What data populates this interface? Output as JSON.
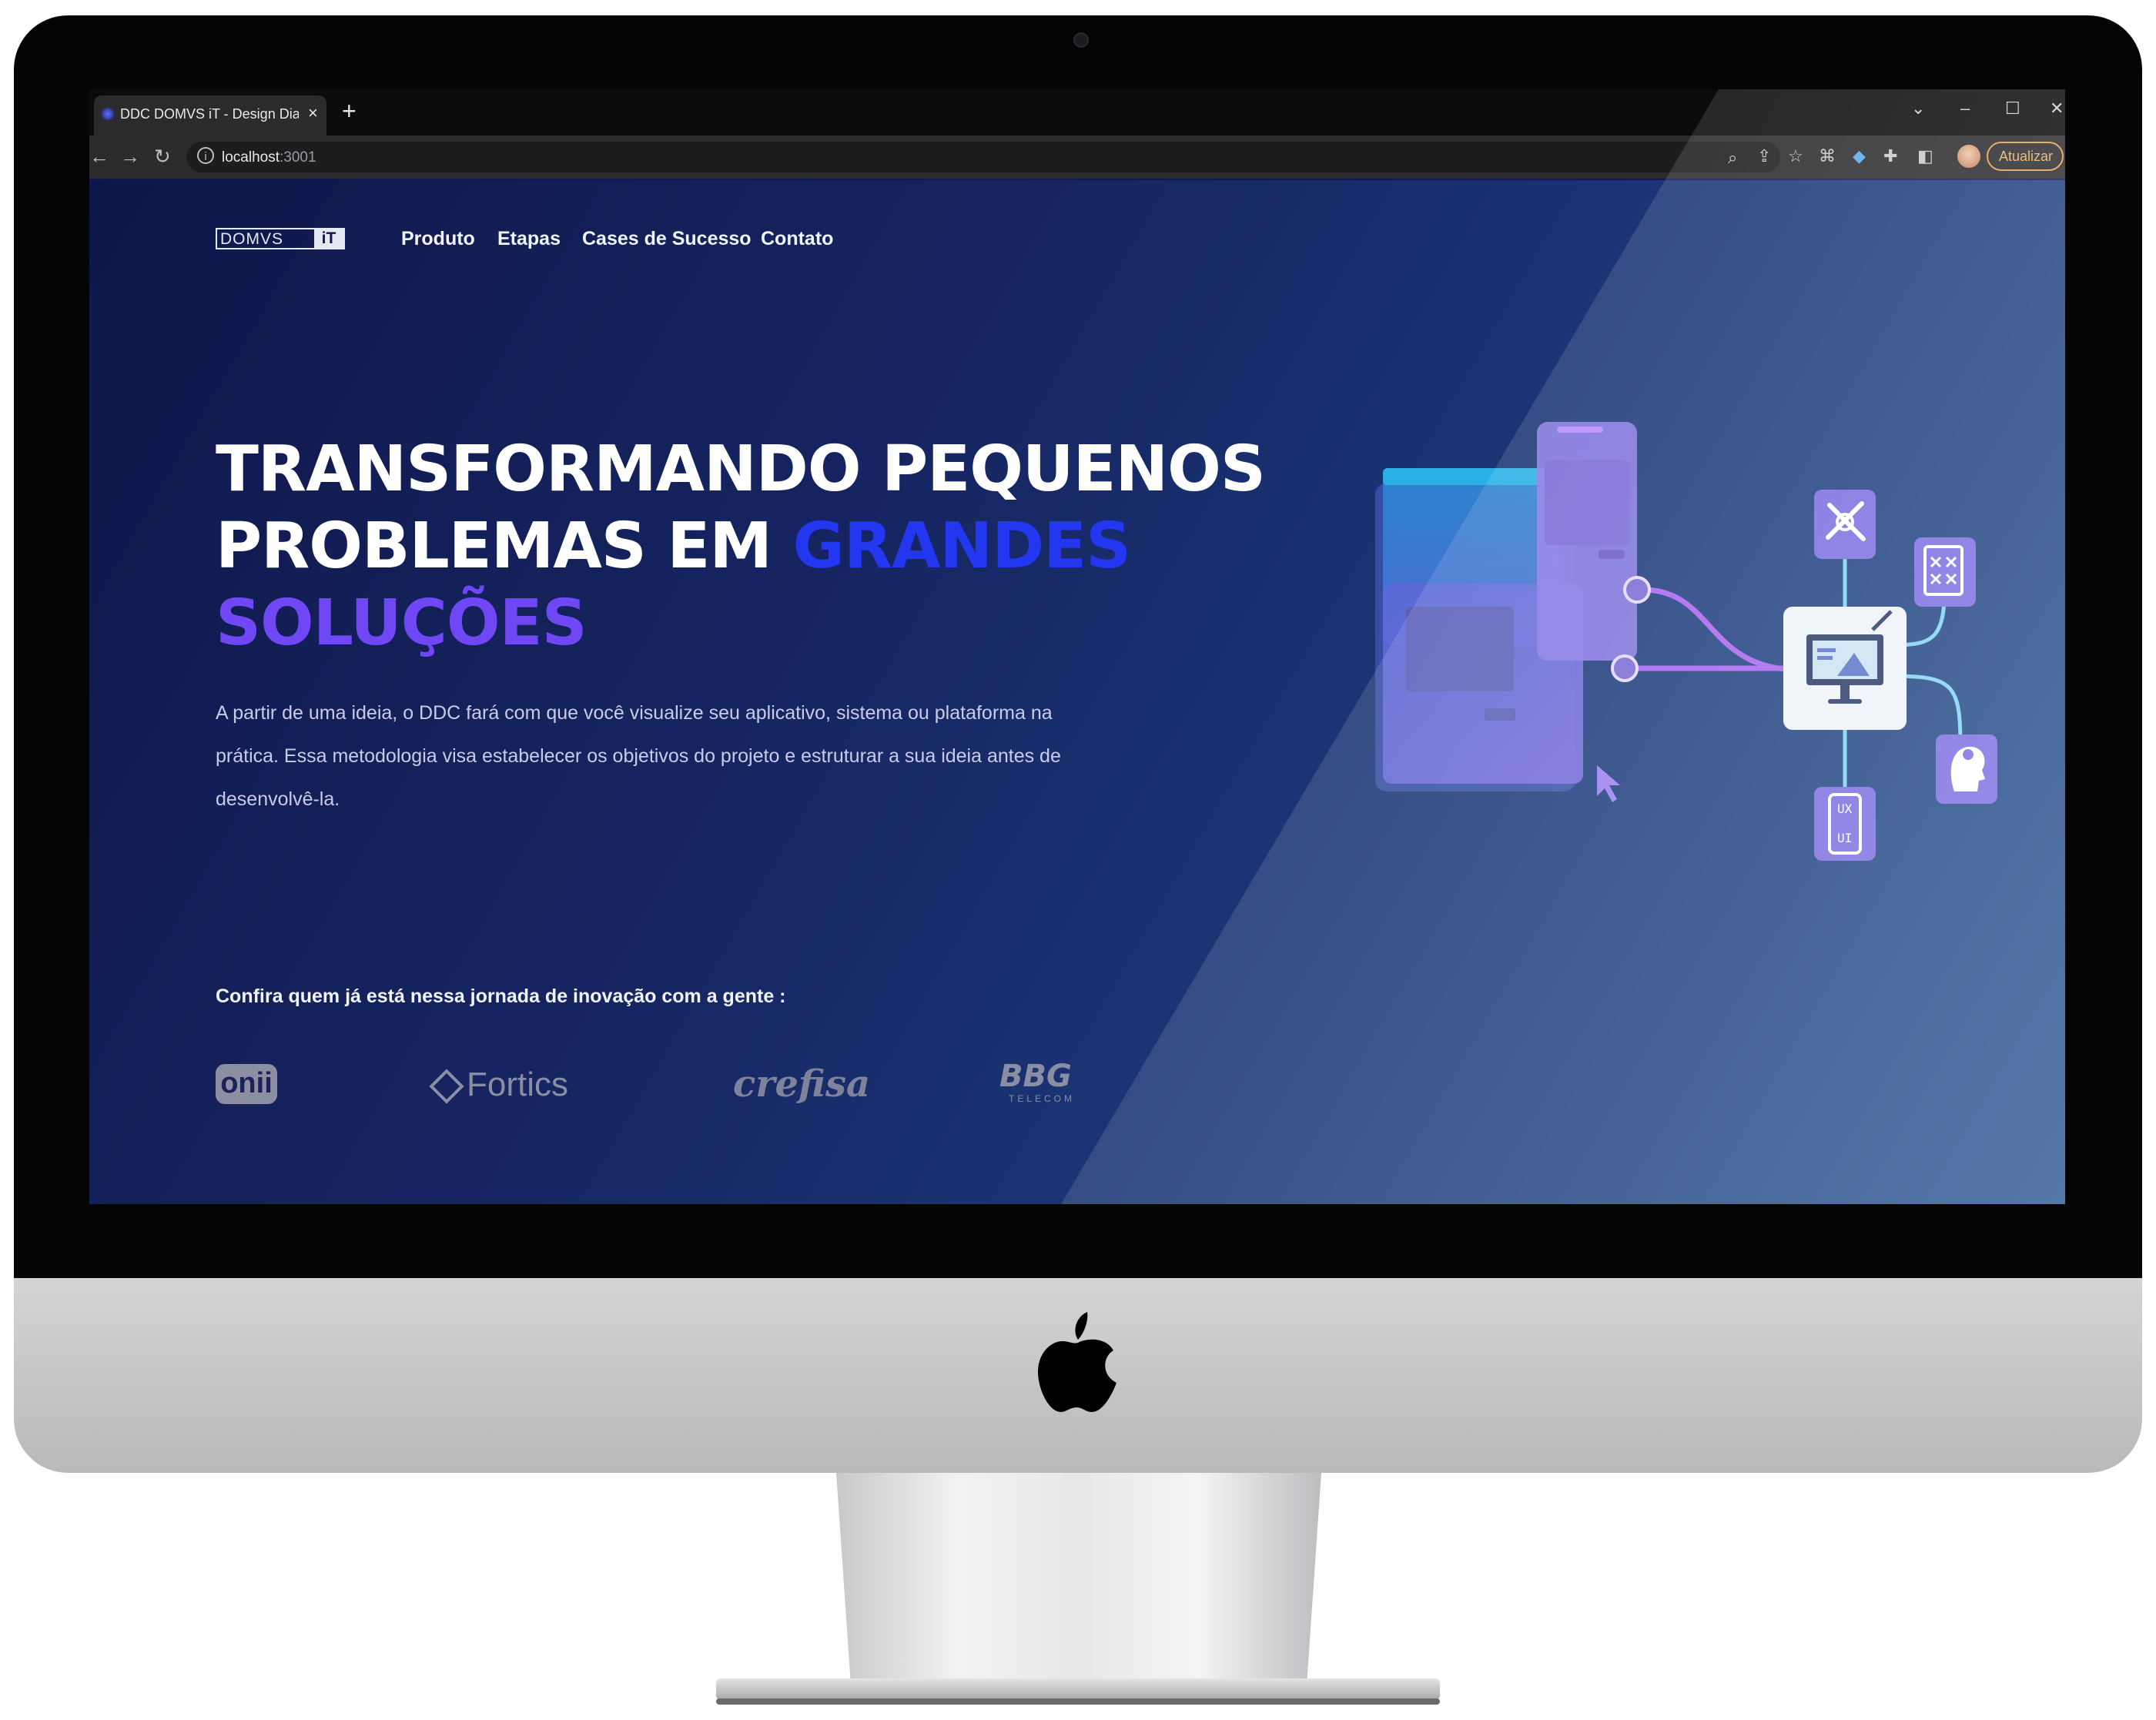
{
  "browser": {
    "tab_title": "DDC DOMVS iT - Design Diamond",
    "tab_close": "×",
    "new_tab": "+",
    "url_host": "localhost",
    "url_port": ":3001",
    "update_label": "Atualizar",
    "window_controls": [
      "chevron-down-icon",
      "minimize-icon",
      "maximize-icon",
      "close-icon"
    ]
  },
  "site": {
    "brand_left": "DOMVS",
    "brand_right": "iT",
    "nav": [
      "Produto",
      "Etapas",
      "Cases de Sucesso",
      "Contato"
    ],
    "headline_line1": "TRANSFORMANDO PEQUENOS",
    "headline_line2_a": "PROBLEMAS EM ",
    "headline_line2_b": "GRANDES",
    "headline_line3": "SOLUÇÕES",
    "intro": "A partir de uma ideia, o DDC fará com que você visualize seu aplicativo, sistema ou plataforma na prática. Essa metodologia visa estabelecer os objetivos do projeto e estruturar a sua ideia antes de desenvolvê-la.",
    "partners_title": "Confira quem já está nessa jornada de inovação com a gente :",
    "partners": {
      "onii": "onii",
      "fortics": "Fortics",
      "crefisa": "crefisa",
      "bbg": "BBG",
      "bbg_sub": "TELECOM"
    },
    "illustration_icons": [
      "design-tools-icon",
      "wireframe-icon",
      "monitor-design-icon",
      "idea-head-icon",
      "ux-ui-phone-icon",
      "cursor-icon"
    ],
    "ux_label": "UX",
    "ui_label": "UI"
  },
  "colors": {
    "page_bg": "#162663",
    "accent_blue": "#2437f0",
    "accent_purple": "#7047f5",
    "illustration_purple": "#7b6ee0",
    "connector_cyan": "#7fd4f2"
  }
}
